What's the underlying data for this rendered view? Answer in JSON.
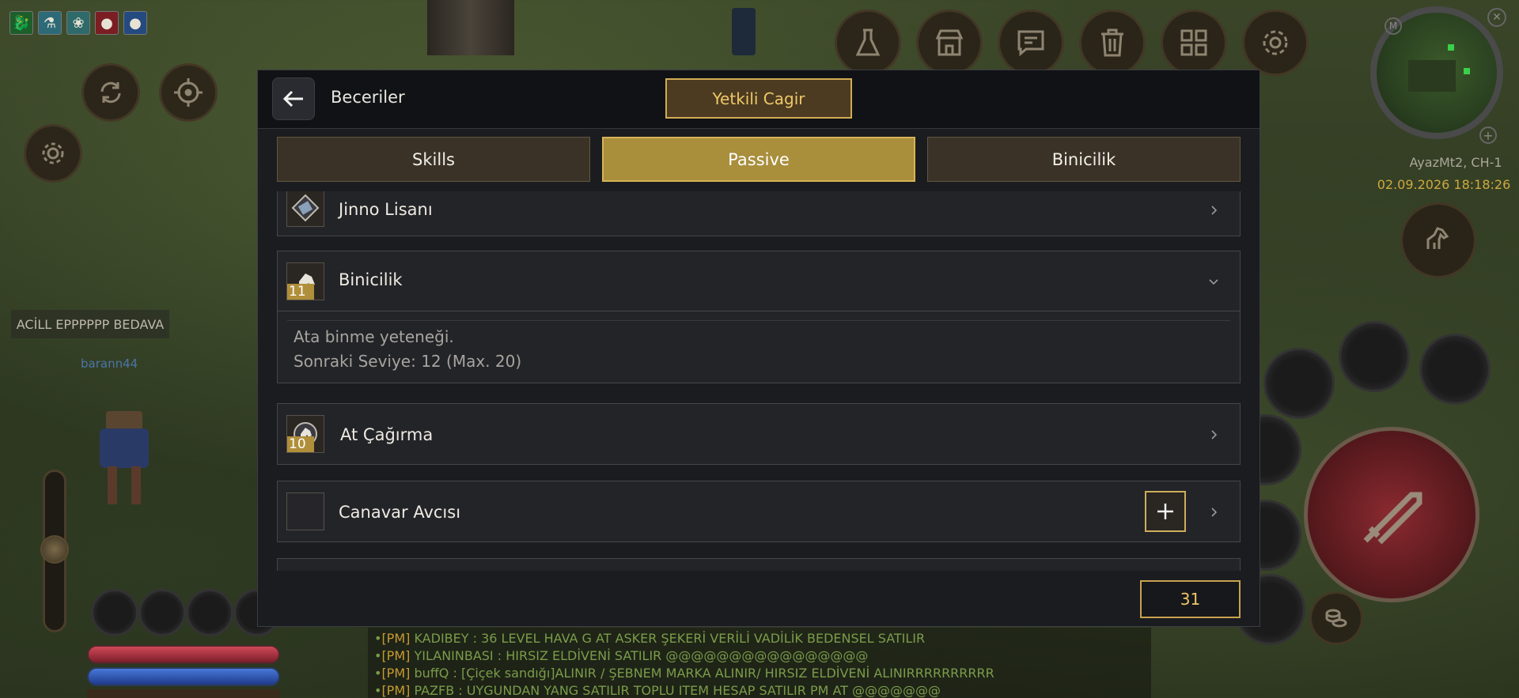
{
  "hud": {
    "buffs": [
      {
        "icon": "dragon-buff-icon",
        "color": "#2aa845"
      },
      {
        "icon": "potion-buff-icon",
        "color": "#4aa2b8"
      },
      {
        "icon": "wind-buff-icon",
        "color": "#5fb0b0"
      },
      {
        "icon": "red-potion-icon",
        "color": "#c0303a"
      },
      {
        "icon": "blue-potion-icon",
        "color": "#3d6db8"
      }
    ],
    "notice_text": "ACİLL EPPPPPP BEDAVA",
    "player_name": "barann44",
    "server_info": "AyazMt2, CH-1",
    "datetime": "02.09.2026 18:18:26",
    "top_buttons": [
      "flask-icon",
      "shop-icon",
      "chat-icon",
      "trash-icon",
      "grid-menu-icon",
      "settings-gear-icon"
    ]
  },
  "panel": {
    "title": "Beceriler",
    "gm_button": "Yetkili Cagir",
    "tabs": [
      {
        "label": "Skills",
        "active": false
      },
      {
        "label": "Passive",
        "active": true
      },
      {
        "label": "Binicilik",
        "active": false
      }
    ],
    "skills": [
      {
        "name": "Jinno Lisanı",
        "level": "",
        "expanded": false
      },
      {
        "name": "Binicilik",
        "level": "11",
        "expanded": true,
        "description": "Ata binme yeteneği.",
        "next_level": "Sonraki Seviye: 12 (Max. 20)"
      },
      {
        "name": "At Çağırma",
        "level": "10",
        "expanded": false
      },
      {
        "name": "Canavar Avcısı",
        "level": "",
        "expanded": false,
        "can_learn": true
      }
    ],
    "skill_points": "31"
  },
  "chat": [
    {
      "prefix": "[PM]",
      "text": "KADIBEY : 36 LEVEL HAVA G AT ASKER ŞEKERİ VERİLİ VADİLİK BEDENSEL SATILIR"
    },
    {
      "prefix": "[PM]",
      "text": "YILANINBASI : HIRSIZ ELDİVENİ SATILIR @@@@@@@@@@@@@@@@"
    },
    {
      "prefix": "[PM]",
      "text": "buffQ : [Çiçek sandığı]ALINIR / ŞEBNEM MARKA ALINIR/ HIRSIZ ELDİVENİ ALINIRRRRRRRRRR"
    },
    {
      "prefix": "[PM]",
      "text": "PAZFB : UYGUNDAN YANG SATILIR TOPLU ITEM HESAP SATILIR PM AT @@@@@@@"
    }
  ]
}
